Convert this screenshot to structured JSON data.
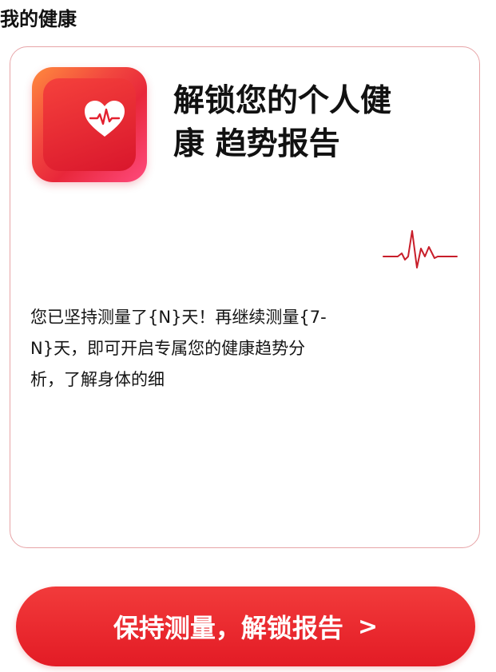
{
  "page": {
    "title": "我的健康"
  },
  "card": {
    "headline_line1": "解锁您的个人健",
    "headline_line2": "康 趋势报告",
    "message_line1": "您已坚持测量了{N}天！再继续测量{7-",
    "message_line2": "N}天，即可开启专属您的健康趋势分",
    "message_line3": "析，了解身体的细",
    "icons": {
      "app": "heart-ecg-app-icon",
      "decoration": "ecg-wave-icon"
    }
  },
  "cta": {
    "label": "保持测量，解锁报告",
    "chevron": ">"
  },
  "colors": {
    "accent": "#e31b25",
    "card_border": "#e7a4a7",
    "ecg_line": "#c81e2a"
  }
}
